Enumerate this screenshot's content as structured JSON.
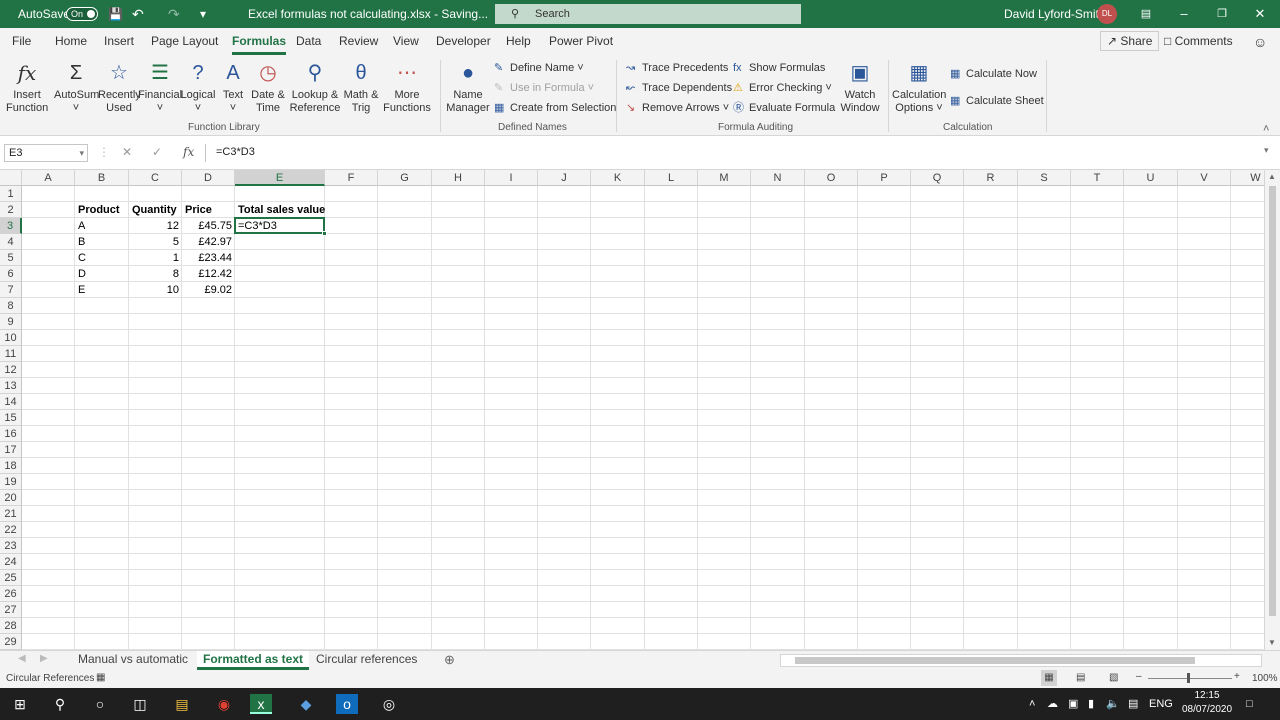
{
  "titlebar": {
    "autosave_label": "AutoSave",
    "autosave_state": "On",
    "filename": "Excel formulas not calculating.xlsx  -  Saving...",
    "search_placeholder": "Search",
    "user_name": "David Lyford-Smith",
    "user_initials": "DL"
  },
  "menu": {
    "tabs": [
      "File",
      "Home",
      "Insert",
      "Page Layout",
      "Formulas",
      "Data",
      "Review",
      "View",
      "Developer",
      "Help",
      "Power Pivot"
    ],
    "share": "Share",
    "comments": "Comments"
  },
  "ribbon": {
    "insert_function": [
      "Insert",
      "Function"
    ],
    "autosum": "AutoSum",
    "recently_used": [
      "Recently",
      "Used"
    ],
    "financial": "Financial",
    "logical": "Logical",
    "text": "Text",
    "date_time": [
      "Date &",
      "Time"
    ],
    "lookup_reference": [
      "Lookup &",
      "Reference"
    ],
    "math_trig": [
      "Math &",
      "Trig"
    ],
    "more_functions": [
      "More",
      "Functions"
    ],
    "group_function_library": "Function Library",
    "name_manager": [
      "Name",
      "Manager"
    ],
    "define_name": "Define Name",
    "use_in_formula": "Use in Formula",
    "create_from_selection": "Create from Selection",
    "group_defined_names": "Defined Names",
    "trace_precedents": "Trace Precedents",
    "trace_dependents": "Trace Dependents",
    "remove_arrows": "Remove Arrows",
    "show_formulas": "Show Formulas",
    "error_checking": "Error Checking",
    "evaluate_formula": "Evaluate Formula",
    "watch_window": [
      "Watch",
      "Window"
    ],
    "group_formula_auditing": "Formula Auditing",
    "calculation_options": [
      "Calculation",
      "Options"
    ],
    "calculate_now": "Calculate Now",
    "calculate_sheet": "Calculate Sheet",
    "group_calculation": "Calculation"
  },
  "formula_bar": {
    "name_box": "E3",
    "formula": "=C3*D3"
  },
  "sheet": {
    "columns": [
      "A",
      "B",
      "C",
      "D",
      "E",
      "F",
      "G",
      "H",
      "I",
      "J",
      "K",
      "L",
      "M",
      "N",
      "O",
      "P",
      "Q",
      "R",
      "S",
      "T",
      "U",
      "V",
      "W"
    ],
    "rows": [
      "1",
      "2",
      "3",
      "4",
      "5",
      "6",
      "7",
      "8",
      "9",
      "10",
      "11",
      "12",
      "13",
      "14",
      "15",
      "16",
      "17",
      "18",
      "19",
      "20",
      "21",
      "22",
      "23",
      "24",
      "25",
      "26",
      "27",
      "28",
      "29"
    ],
    "headers": {
      "product": "Product",
      "quantity": "Quantity",
      "price": "Price",
      "total": "Total sales value"
    },
    "data": [
      {
        "product": "A",
        "quantity": "12",
        "price": "£45.75",
        "total": "=C3*D3"
      },
      {
        "product": "B",
        "quantity": "5",
        "price": "£42.97",
        "total": ""
      },
      {
        "product": "C",
        "quantity": "1",
        "price": "£23.44",
        "total": ""
      },
      {
        "product": "D",
        "quantity": "8",
        "price": "£12.42",
        "total": ""
      },
      {
        "product": "E",
        "quantity": "10",
        "price": "£9.02",
        "total": ""
      }
    ]
  },
  "tabs": {
    "sheets": [
      "Manual vs automatic",
      "Formatted as text",
      "Circular references"
    ],
    "active": "Formatted as text"
  },
  "status": {
    "left": "Circular References",
    "zoom": "100%"
  },
  "taskbar": {
    "lang": "ENG",
    "time": "12:15",
    "date": "08/07/2020"
  },
  "colors": {
    "accent": "#217346"
  }
}
